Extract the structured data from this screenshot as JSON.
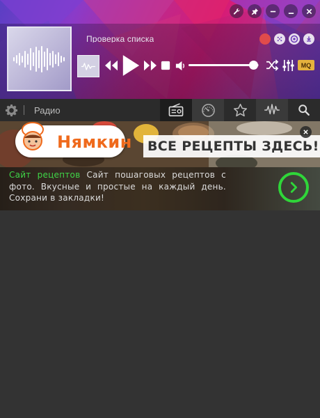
{
  "window": {
    "controls": [
      {
        "name": "settings-wrench-icon"
      },
      {
        "name": "pin-icon"
      },
      {
        "name": "collapse-icon"
      },
      {
        "name": "minimize-icon"
      },
      {
        "name": "close-icon"
      }
    ]
  },
  "player": {
    "track_title": "Проверка списка",
    "volume": 0.92,
    "status_colors": {
      "record": "#e14b4b",
      "accent": "#e5b13d"
    },
    "quality_badge": "MQ"
  },
  "toolbar": {
    "section_label": "Радио",
    "tabs": [
      {
        "name": "radio-icon",
        "active": true
      },
      {
        "name": "speedometer-icon",
        "active": false
      },
      {
        "name": "star-icon",
        "active": false
      },
      {
        "name": "waveform-icon",
        "active": false
      }
    ]
  },
  "ad": {
    "brand": "Нямкин",
    "slogan": "ВСЕ РЕЦЕПТЫ ЗДЕСЬ!",
    "link_text": "Сайт рецептов",
    "body_text": " Сайт пошаговых рецептов с фото. Вкусные и простые на каждый день. Сохрани в закладки!",
    "link_color": "#3fd648"
  }
}
